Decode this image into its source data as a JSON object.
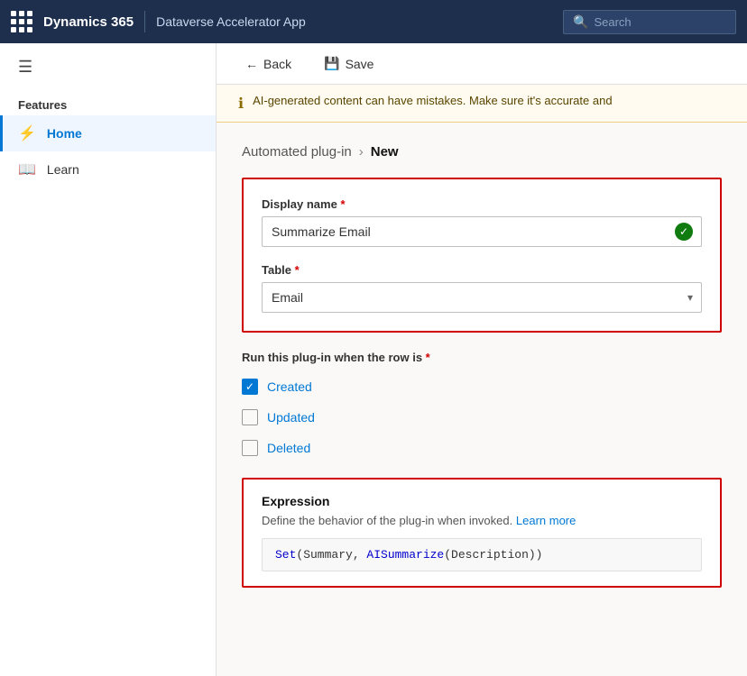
{
  "topbar": {
    "title": "Dynamics 365",
    "app_name": "Dataverse Accelerator App",
    "search_placeholder": "Search"
  },
  "sidebar": {
    "menu_icon": "☰",
    "section_label": "Features",
    "items": [
      {
        "id": "home",
        "label": "Home",
        "icon": "⚡",
        "active": true
      },
      {
        "id": "learn",
        "label": "Learn",
        "icon": "📖",
        "active": false
      }
    ]
  },
  "toolbar": {
    "back_label": "Back",
    "save_label": "Save"
  },
  "warning": {
    "text": "AI-generated content can have mistakes. Make sure it's accurate and"
  },
  "breadcrumb": {
    "parent": "Automated plug-in",
    "separator": "›",
    "current": "New"
  },
  "form": {
    "display_name_label": "Display name",
    "display_name_value": "Summarize Email",
    "table_label": "Table",
    "table_value": "Email",
    "run_label": "Run this plug-in when the row is",
    "checkboxes": [
      {
        "id": "created",
        "label": "Created",
        "checked": true
      },
      {
        "id": "updated",
        "label": "Updated",
        "checked": false
      },
      {
        "id": "deleted",
        "label": "Deleted",
        "checked": false
      }
    ]
  },
  "expression": {
    "title": "Expression",
    "desc": "Define the behavior of the plug-in when invoked.",
    "learn_more": "Learn more",
    "code": "Set(Summary, AISummarize(Description))"
  },
  "colors": {
    "accent": "#0078d4",
    "danger": "#d00000",
    "success": "#107c10",
    "topbar_bg": "#1e2f4d"
  }
}
